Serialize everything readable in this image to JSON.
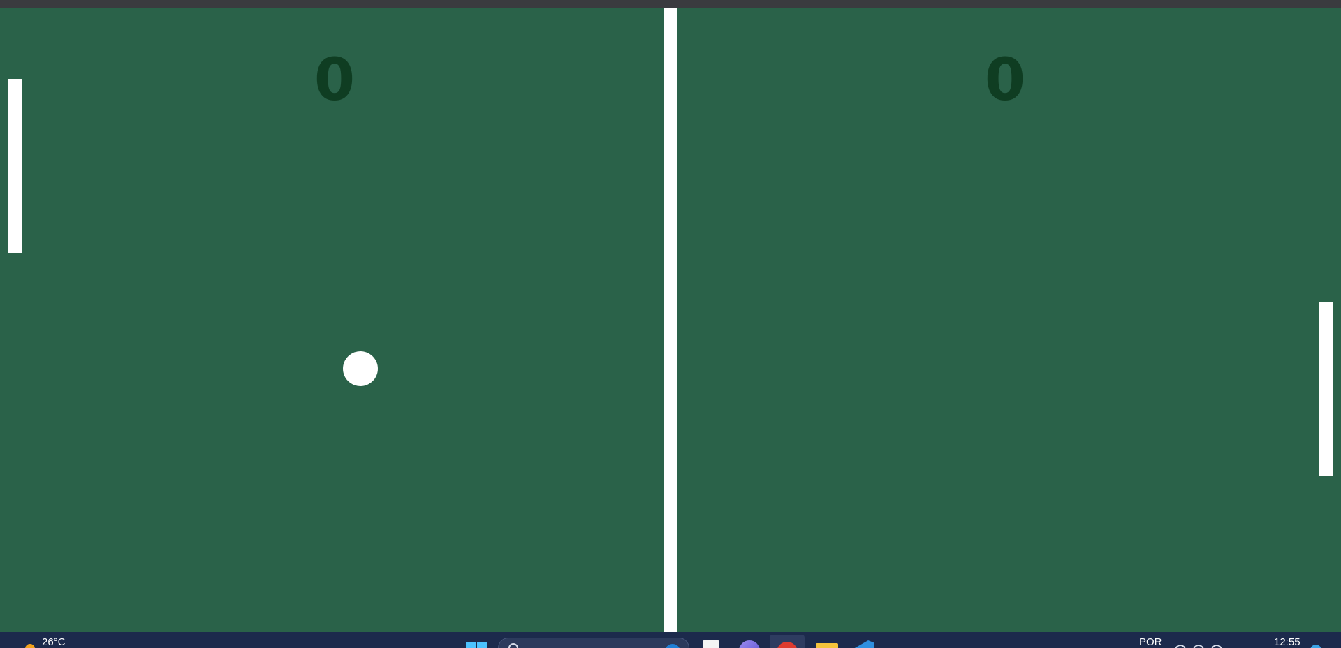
{
  "game": {
    "left_score": "0",
    "right_score": "0",
    "colors": {
      "court": "#2a6249",
      "score": "#0f3d22",
      "paddle": "#ffffff",
      "ball": "#ffffff",
      "net": "#ffffff"
    }
  },
  "taskbar": {
    "weather_temp": "26°C",
    "language": "POR",
    "clock_time": "12:55",
    "icons": [
      "sun-icon",
      "windows-start-icon",
      "search-icon",
      "bing-icon",
      "task-view-icon",
      "chat-icon",
      "chrome-icon",
      "folder-icon",
      "vscode-icon",
      "wifi-icon",
      "volume-icon",
      "battery-icon",
      "notification-icon"
    ]
  }
}
